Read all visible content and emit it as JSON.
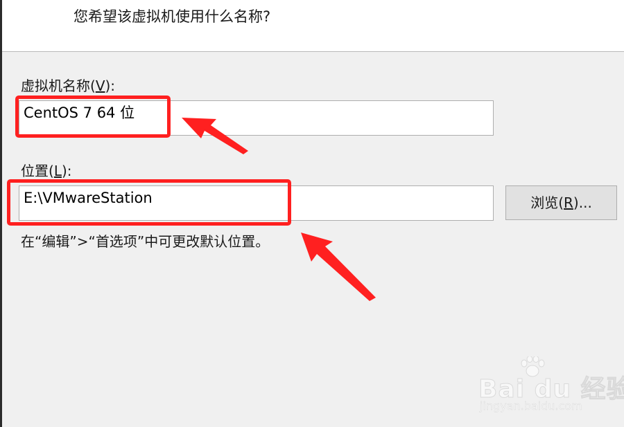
{
  "header": {
    "question": "您希望该虚拟机使用什么名称?"
  },
  "name_field": {
    "label_prefix": "虚拟机名称(",
    "label_key": "V",
    "label_suffix": "):",
    "value": "CentOS 7 64 位"
  },
  "location_field": {
    "label_prefix": "位置(",
    "label_key": "L",
    "label_suffix": "):",
    "value": "E:\\VMwareStation"
  },
  "browse_button": {
    "label_prefix": "浏览(",
    "label_key": "R",
    "label_suffix": ")..."
  },
  "hint": "在“编辑”>“首选项”中可更改默认位置。",
  "watermark": {
    "logo": "Bai du 经验",
    "url": "jingyan.baidu.com"
  },
  "annotation_color": "#ff2020"
}
